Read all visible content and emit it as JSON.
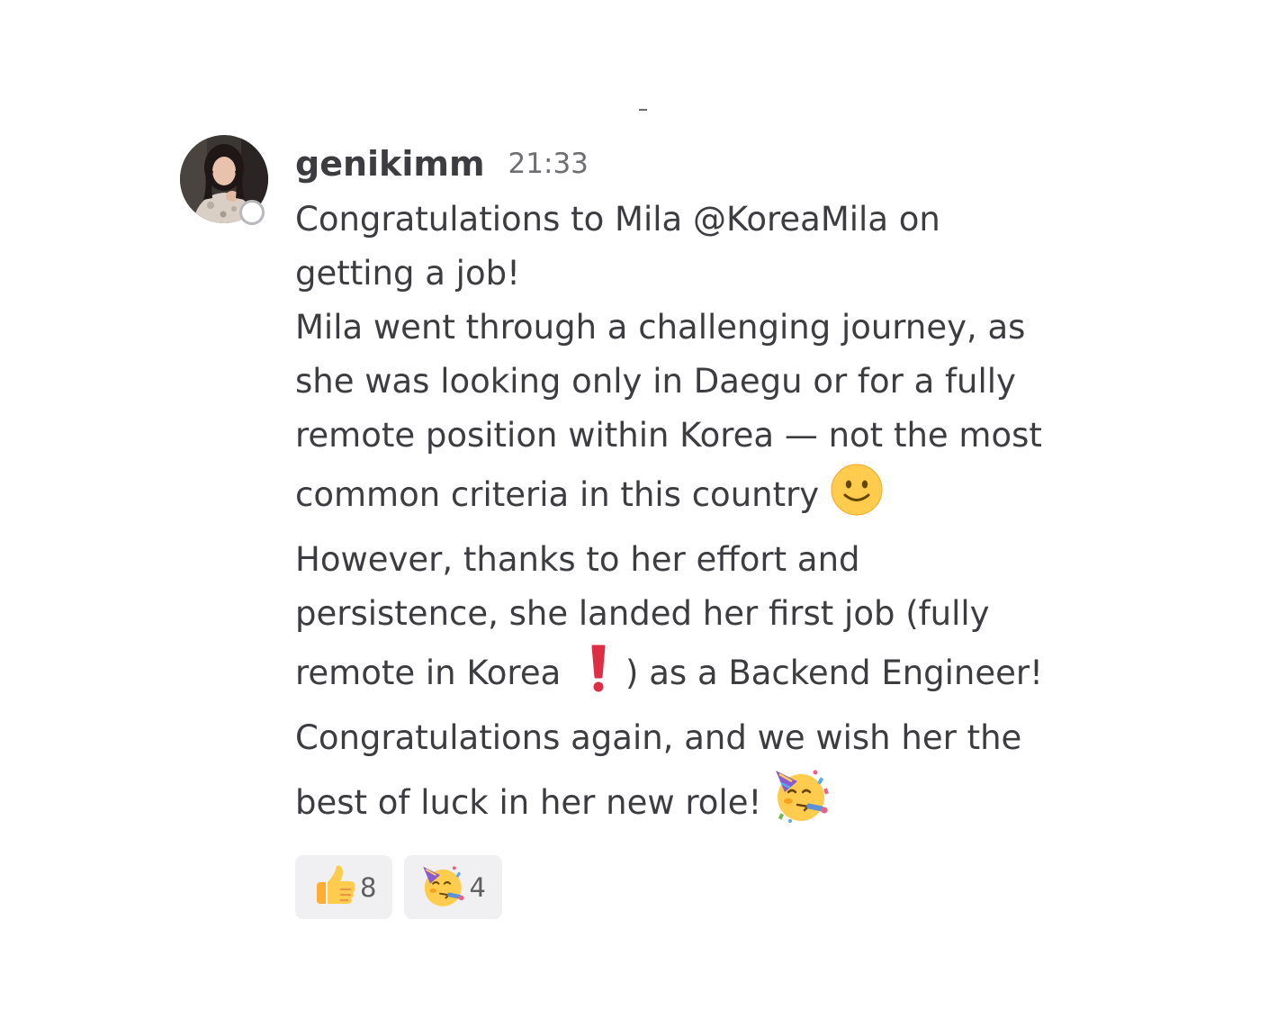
{
  "message": {
    "author": "genikimm",
    "time": "21:33",
    "status": "offline",
    "avatar_icon": "user-photo-avatar",
    "lines": {
      "l1": "Congratulations to Mila @KoreaMila on",
      "l2": "getting a job!",
      "l3": "Mila went through a challenging journey, as",
      "l4": "she was looking only in Daegu or for a fully",
      "l5": "remote position within Korea — not the most",
      "l6": "common criteria in this country",
      "l7": "However, thanks to her effort and",
      "l8": "persistence, she landed her first job (fully",
      "l9a": "remote in Korea",
      "l9b": ") as a Backend Engineer!",
      "l10": "Congratulations again, and we wish her the",
      "l11": "best of luck in her new role!"
    },
    "inline_emojis": [
      "slightly-smiling-face-emoji",
      "exclamation-emoji",
      "partying-face-emoji"
    ]
  },
  "reactions": [
    {
      "emoji": "thumbs-up-emoji",
      "count": "8"
    },
    {
      "emoji": "partying-face-emoji",
      "count": "4"
    }
  ],
  "colors": {
    "text": "#3d3c40",
    "muted": "#6e6e73",
    "reaction_bg": "#f0f0f2",
    "exclamation": "#dd2e44"
  }
}
